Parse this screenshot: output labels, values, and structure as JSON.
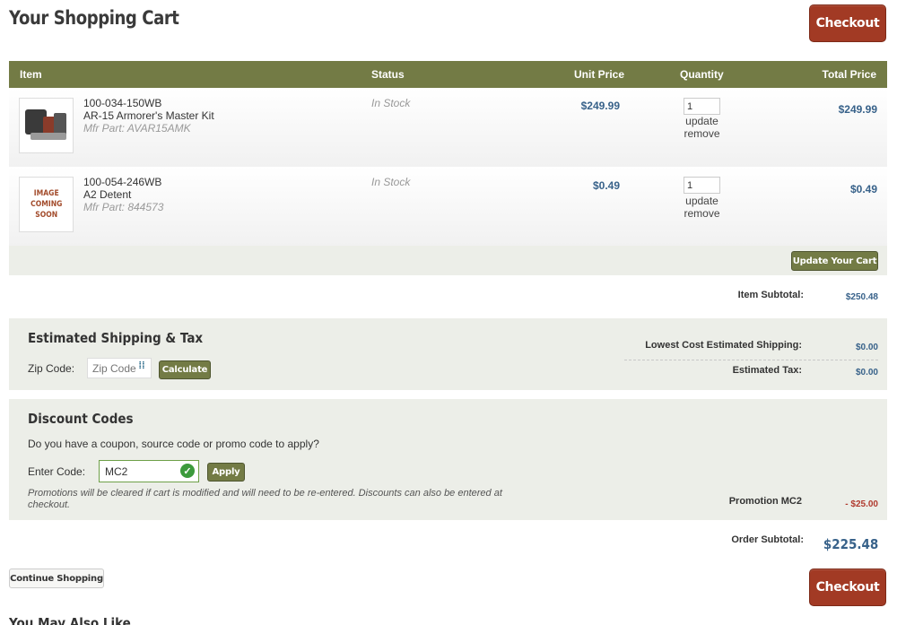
{
  "page": {
    "title": "Your Shopping Cart",
    "checkout_label": "Checkout",
    "continue_label": "Continue Shopping",
    "also_like_heading": "You May Also Like"
  },
  "cart": {
    "columns": [
      "Item",
      "Status",
      "Unit Price",
      "Quantity",
      "Total Price"
    ],
    "items": [
      {
        "sku": "100-034-150WB",
        "name": "AR-15 Armorer's Master Kit",
        "mfr_part": "Mfr Part: AVAR15AMK",
        "status": "In Stock",
        "unit_price": "$249.99",
        "quantity": "1",
        "update_label": "update",
        "remove_label": "remove",
        "total_price": "$249.99",
        "image": "armorer-kit-photo"
      },
      {
        "sku": "100-054-246WB",
        "name": "A2 Detent",
        "mfr_part": "Mfr Part: 844573",
        "status": "In Stock",
        "unit_price": "$0.49",
        "quantity": "1",
        "update_label": "update",
        "remove_label": "remove",
        "total_price": "$0.49",
        "image": "image-coming-soon-placeholder",
        "placeholder_text_lines": [
          "IMAGE",
          "COMING",
          "SOON"
        ]
      }
    ],
    "update_cart_label": "Update Your Cart",
    "item_subtotal_label": "Item Subtotal:",
    "item_subtotal_value": "$250.48"
  },
  "shipping": {
    "heading": "Estimated Shipping & Tax",
    "zip_label": "Zip Code:",
    "zip_placeholder": "Zip Code",
    "calculate_label": "Calculate",
    "shipping_label": "Lowest Cost Estimated Shipping:",
    "shipping_value": "$0.00",
    "tax_label": "Estimated Tax:",
    "tax_value": "$0.00"
  },
  "discount": {
    "heading": "Discount Codes",
    "question": "Do you have a coupon, source code or promo code to apply?",
    "enter_label": "Enter Code:",
    "code_value": "MC2",
    "apply_label": "Apply",
    "note": "Promotions will be cleared if cart is modified and will need to be re-entered. Discounts can also be entered at checkout.",
    "promotion_label": "Promotion MC2",
    "promotion_value": "- $25.00"
  },
  "summary": {
    "order_subtotal_label": "Order Subtotal:",
    "order_subtotal_value": "$225.48"
  },
  "colors": {
    "header_olive": "#737b45",
    "checkout_red": "#a23a24",
    "price_blue": "#38628a",
    "discount_red": "#b03a2e",
    "panel_gray": "#eceee8"
  }
}
